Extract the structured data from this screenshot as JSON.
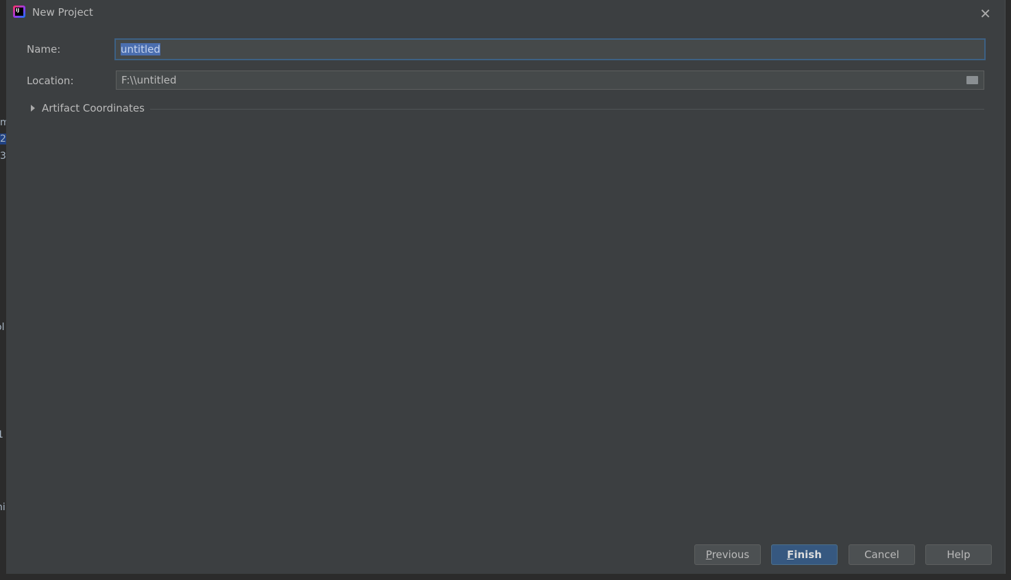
{
  "background_fragments": [
    "m",
    "2",
    "3",
    "ol",
    "1",
    "ni"
  ],
  "dialog": {
    "title": "New Project",
    "app_icon_text": "IJ",
    "close_glyph": "✕",
    "name_label": "Name:",
    "name_value": "untitled",
    "location_label": "Location:",
    "location_value": "F:\\\\untitled",
    "artifact_section": "Artifact Coordinates",
    "buttons": {
      "previous": {
        "mnemonic": "P",
        "rest": "revious"
      },
      "finish": {
        "mnemonic": "F",
        "rest": "inish"
      },
      "cancel": "Cancel",
      "help": "Help"
    }
  },
  "colors": {
    "dialog_bg": "#3c3f41",
    "primary_button": "#365880",
    "selection": "#4b6eaf",
    "focus_border": "#3d6185"
  }
}
